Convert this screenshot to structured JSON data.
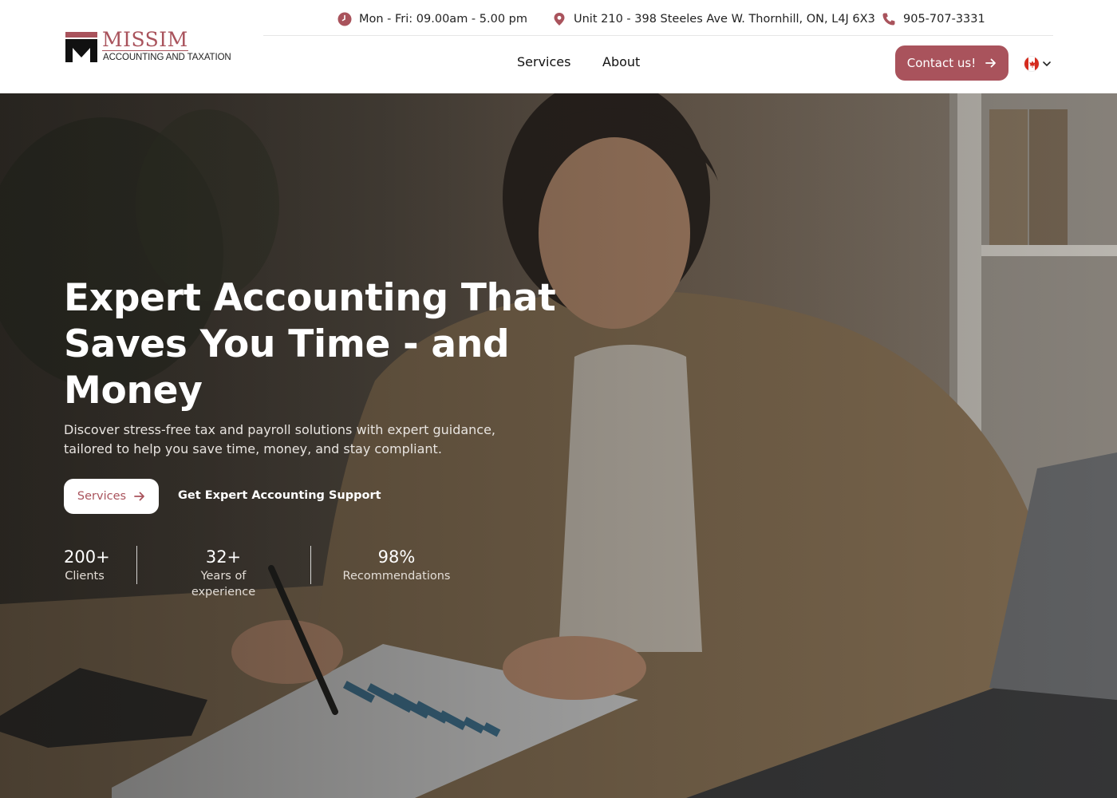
{
  "brand": {
    "name": "MISSIM",
    "tagline": "ACCOUNTING AND TAXATION",
    "colors": {
      "accent": "#a9535c",
      "text": "#111111",
      "white": "#ffffff"
    }
  },
  "topbar": {
    "hours": {
      "icon": "clock-icon",
      "text": "Mon - Fri: 09.00am - 5.00 pm"
    },
    "address": {
      "icon": "location-pin-icon",
      "text": "Unit 210 - 398 Steeles Ave W. Thornhill, ON, L4J 6X3"
    },
    "phone": {
      "icon": "phone-icon",
      "text": "905-707-3331"
    }
  },
  "nav": {
    "items": [
      {
        "label": "Services"
      },
      {
        "label": "About"
      }
    ],
    "contact_label": "Contact us!",
    "language": {
      "icon": "canada-flag-icon"
    }
  },
  "hero": {
    "title": "Expert Accounting That Saves You Time - and Money",
    "subtitle": "Discover stress-free tax and payroll solutions with expert guidance, tailored to help you save time, money, and stay compliant.",
    "primary_button": "Services",
    "secondary_link": "Get Expert Accounting Support",
    "stats": [
      {
        "value": "200+",
        "label": "Clients"
      },
      {
        "value": "32+",
        "label": "Years of experience"
      },
      {
        "value": "98%",
        "label": "Recommendations"
      }
    ]
  }
}
